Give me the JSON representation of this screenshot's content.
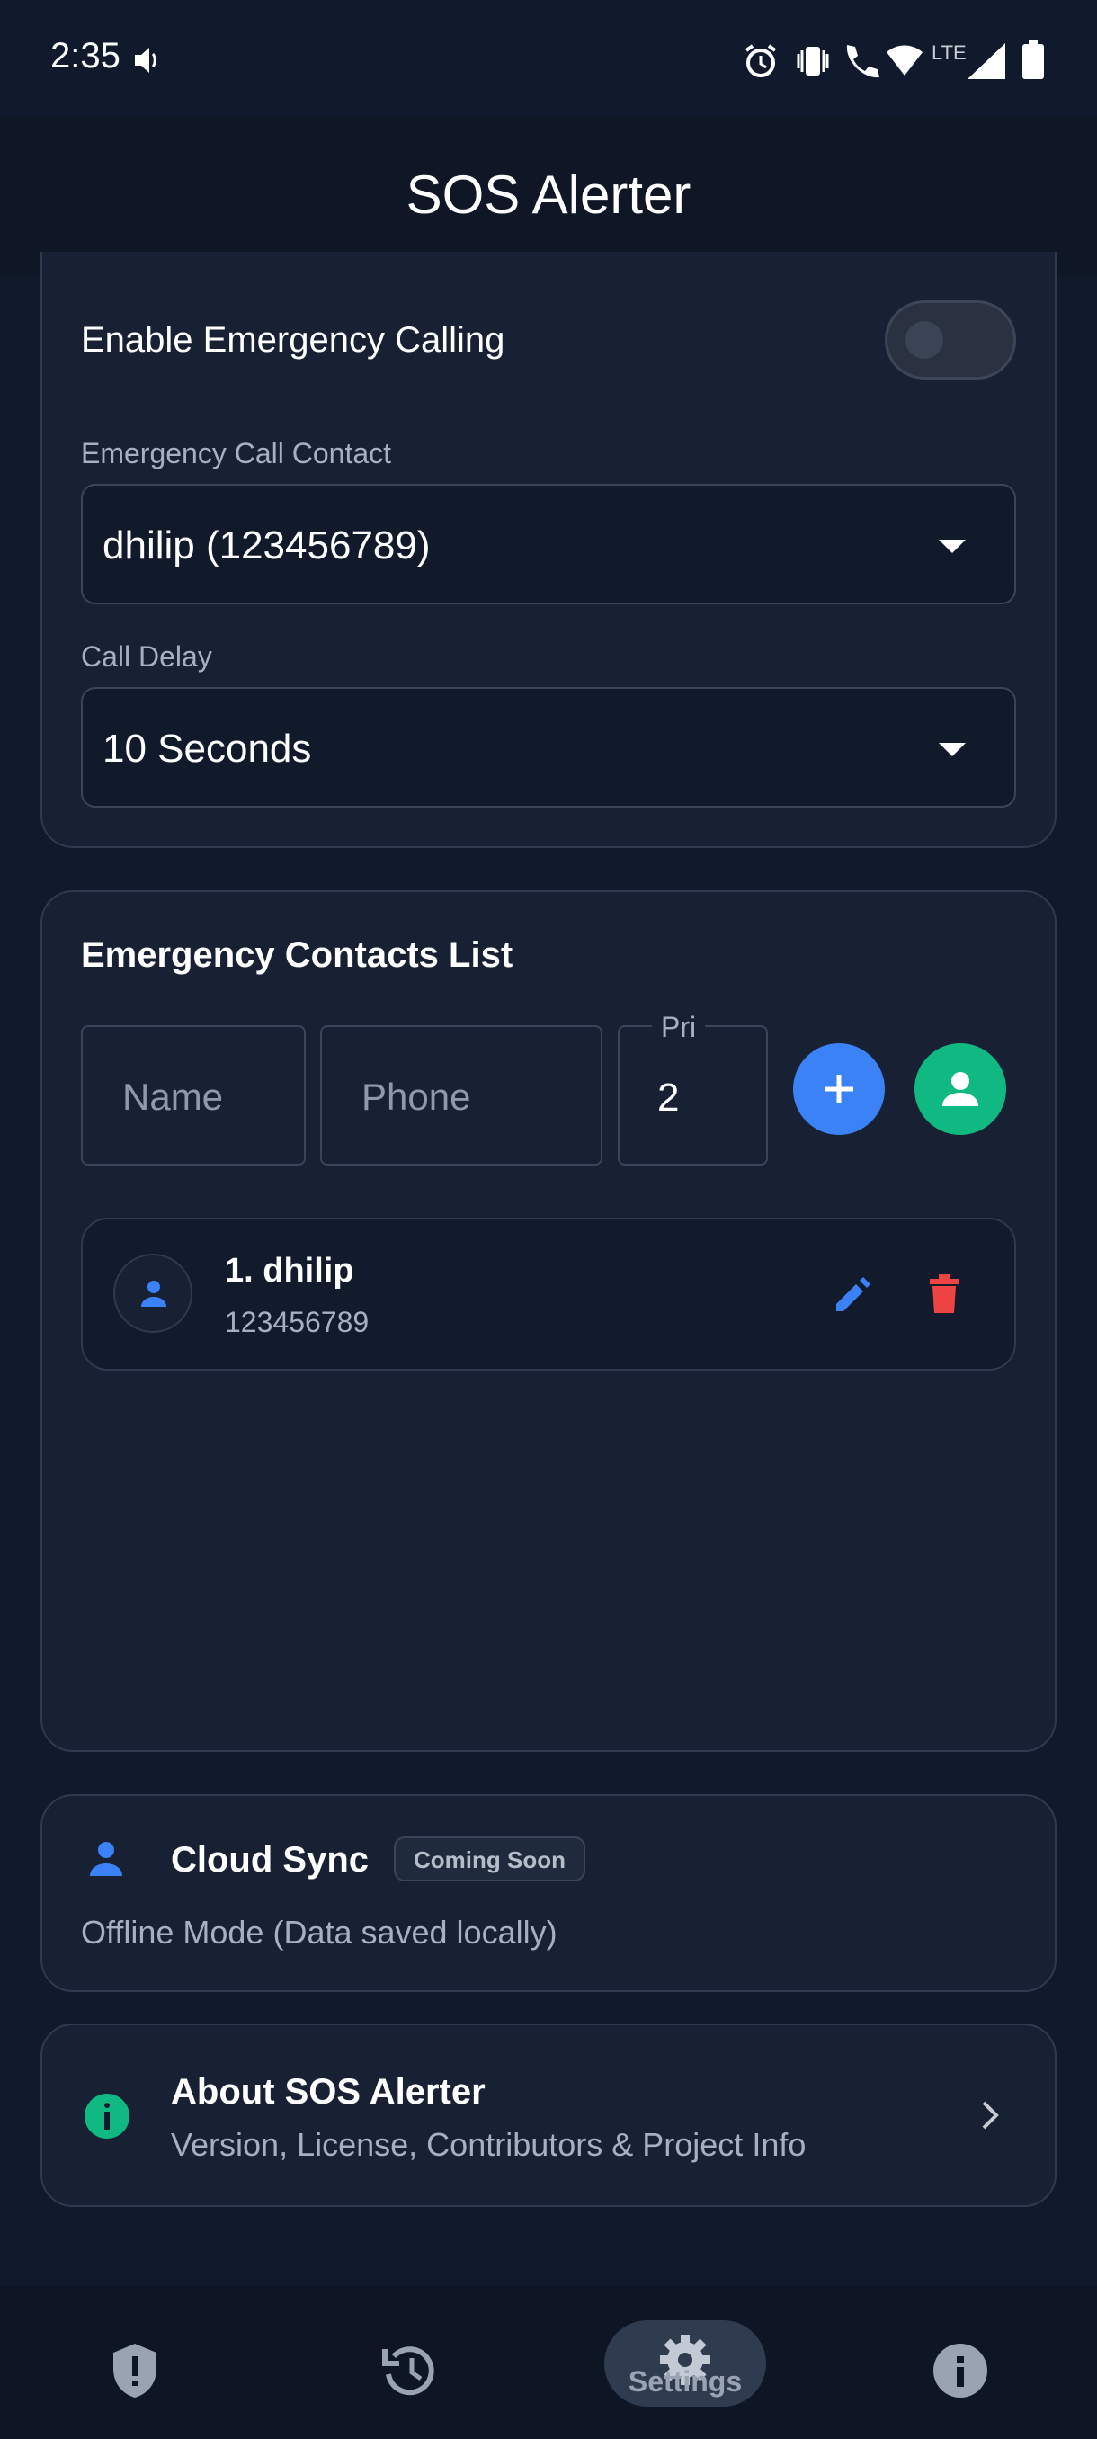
{
  "status_bar": {
    "time": "2:35",
    "network": "LTE"
  },
  "header": {
    "title": "SOS Alerter"
  },
  "calling": {
    "enable_label": "Enable Emergency Calling",
    "enabled": false,
    "contact_label": "Emergency Call Contact",
    "contact_value": "dhilip (123456789)",
    "delay_label": "Call Delay",
    "delay_value": "10 Seconds"
  },
  "contacts": {
    "title": "Emergency Contacts List",
    "name_placeholder": "Name",
    "phone_placeholder": "Phone",
    "priority_label": "Pri",
    "priority_value": "2",
    "items": [
      {
        "title": "1. dhilip",
        "phone": "123456789"
      }
    ]
  },
  "cloud_sync": {
    "title": "Cloud Sync",
    "badge": "Coming Soon",
    "status": "Offline Mode (Data saved locally)"
  },
  "about": {
    "title": "About SOS Alerter",
    "subtitle": "Version, License, Contributors & Project Info"
  },
  "nav": {
    "items": [
      {
        "icon": "shield-alert-icon"
      },
      {
        "icon": "history-icon"
      },
      {
        "icon": "gear-icon",
        "label": "Settings"
      },
      {
        "icon": "info-icon"
      }
    ]
  },
  "colors": {
    "accent_blue": "#3b82f6",
    "accent_green": "#10b981",
    "danger_red": "#ef4444",
    "background": "#111a2b",
    "card": "#172133"
  }
}
